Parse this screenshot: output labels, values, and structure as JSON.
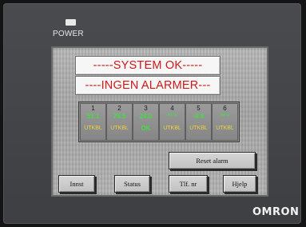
{
  "power": {
    "label": "POWER"
  },
  "screen": {
    "status_line": "-----SYSTEM OK-----",
    "alarm_line": "----INGEN ALARMER---"
  },
  "zones": [
    {
      "num": "1",
      "value": "51.1",
      "status": "UTKBL"
    },
    {
      "num": "2",
      "value": "76.5",
      "status": "UTKBL"
    },
    {
      "num": "3",
      "value": "24.0",
      "status": "OK"
    },
    {
      "num": "4",
      "value": "** *",
      "status": "UTKBL"
    },
    {
      "num": "5",
      "value": "-0.6",
      "status": "UTKBL"
    },
    {
      "num": "6",
      "value": "** *",
      "status": "UTKBL"
    }
  ],
  "buttons": {
    "reset": "Reset alarm",
    "innst": "Innst",
    "status": "Status",
    "tlf": "Tlf. nr",
    "hjelp": "Hjelp"
  },
  "brand": {
    "logo": "OMRON"
  },
  "colors": {
    "alarm_text": "#d01818",
    "value_green": "#3fe03f",
    "status_yellow": "#f0d23a"
  }
}
